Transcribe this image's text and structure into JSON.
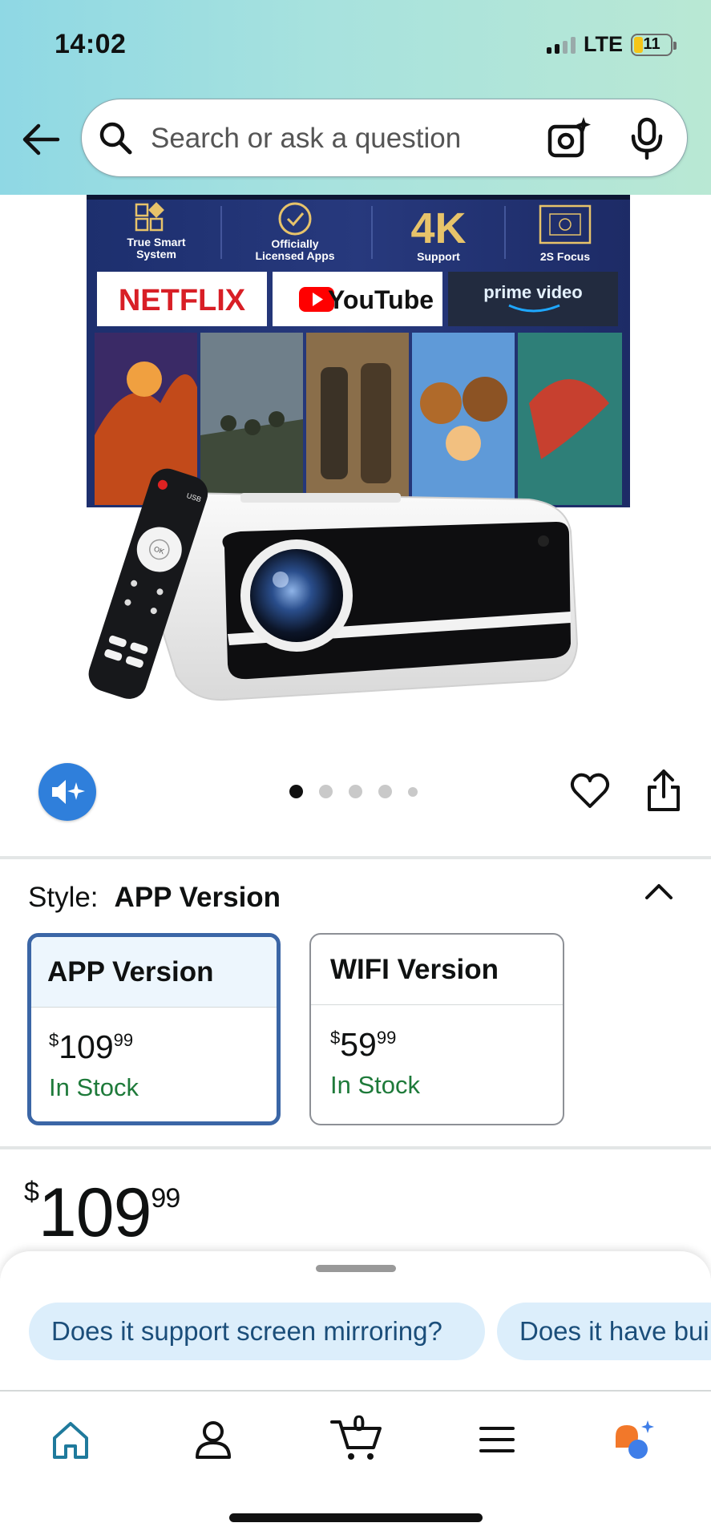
{
  "status_bar": {
    "time": "14:02",
    "network": "LTE",
    "battery": "11"
  },
  "search": {
    "placeholder": "Search or ask a question"
  },
  "product_image": {
    "features": [
      {
        "label_line1": "True Smart",
        "label_line2": "System"
      },
      {
        "label_line1": "Officially",
        "label_line2": "Licensed Apps"
      },
      {
        "label_big": "4K",
        "label_line1": "Support"
      },
      {
        "label_line1": "2S Focus"
      }
    ],
    "apps": {
      "netflix": "NETFLIX",
      "youtube": "YouTube",
      "prime": "prime video"
    },
    "remote_labels": {
      "usb": "USB",
      "ok": "OK"
    }
  },
  "carousel": {
    "total": 5,
    "active_index": 0
  },
  "style": {
    "label": "Style:",
    "selected_value": "APP Version",
    "options": [
      {
        "name": "APP Version",
        "currency": "$",
        "price_whole": "109",
        "price_cents": "99",
        "stock": "In Stock",
        "selected": true
      },
      {
        "name": "WIFI Version",
        "currency": "$",
        "price_whole": "59",
        "price_cents": "99",
        "stock": "In Stock",
        "selected": false
      }
    ]
  },
  "price": {
    "currency": "$",
    "whole": "109",
    "cents": "99"
  },
  "suggestions": [
    "Does it support screen mirroring?",
    "Does it have bui"
  ],
  "nav": {
    "cart_count": "0"
  },
  "colors": {
    "accent_blue": "#2f7fdb",
    "selected_border": "#3b66a6",
    "stock_green": "#1e7a3a",
    "chip_bg": "#dceefb"
  }
}
